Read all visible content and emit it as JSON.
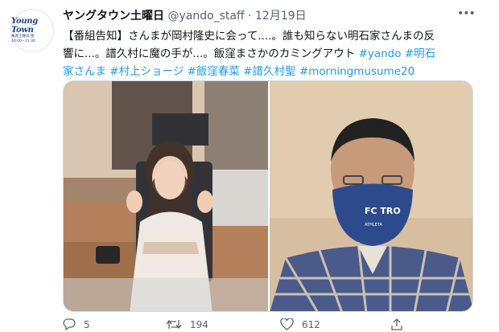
{
  "account": {
    "display_name": "ヤングタウン土曜日",
    "handle": "@yando_staff",
    "separator": "·",
    "date": "12月19日",
    "avatar": {
      "logo_text": "Young Town",
      "logo_subtext": "毎週土曜日 夜10:00~11:30"
    }
  },
  "more_menu": {
    "label": "•••",
    "icon": "more-horizontal-icon"
  },
  "tweet": {
    "text_lines": [
      "【番組告知】さんまが岡村隆史に会って....。誰も知らない明石家さんまの反",
      "響に...。譜久村に魔の手が...。飯窪まさかのカミングアウト"
    ],
    "hashtags_line1": "#yando #明石",
    "hashtags_line2": "家さんま #村上ショージ #飯窪春菜 #譜久村聖 #morningmusume20"
  },
  "media": {
    "left_photo": {
      "subject": "woman-peace-sign-studio"
    },
    "right_photo": {
      "subject": "man-wearing-mask",
      "mask_text": "FC TRO",
      "mask_subtext": "ATHLETA"
    }
  },
  "actions": {
    "reply": {
      "count": "5",
      "icon": "reply-icon"
    },
    "retweet": {
      "count": "194",
      "icon": "retweet-icon"
    },
    "like": {
      "count": "612",
      "icon": "heart-icon"
    },
    "share": {
      "icon": "share-icon"
    }
  },
  "colors": {
    "link": "#1d9bf0",
    "text": "#0f1419",
    "secondary": "#536471",
    "brand": "#1d3f8c"
  }
}
